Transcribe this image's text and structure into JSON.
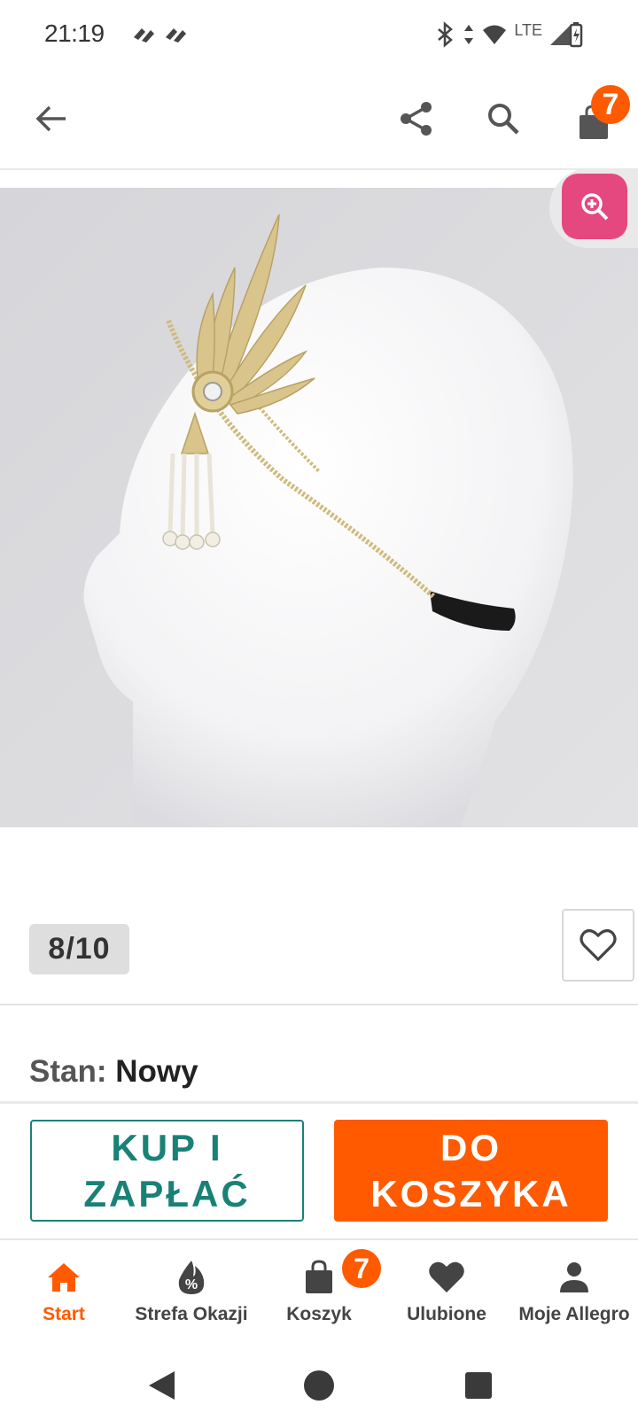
{
  "status_bar": {
    "time": "21:19",
    "network": "LTE"
  },
  "header": {
    "cart_count": "7",
    "icons": [
      "back-arrow-icon",
      "share-icon",
      "search-icon",
      "shopping-bag-icon"
    ]
  },
  "gallery": {
    "counter": "8/10",
    "zoom_icon": "zoom-in-icon"
  },
  "product": {
    "condition_label": "Stan:",
    "condition_value": "Nowy"
  },
  "actions": {
    "buy_now_line1": "KUP I",
    "buy_now_line2": "ZAPŁAĆ",
    "add_to_cart_line1": "DO",
    "add_to_cart_line2": "KOSZYKA"
  },
  "bottom_nav": {
    "items": [
      {
        "label": "Start",
        "icon": "home-icon",
        "active": true
      },
      {
        "label": "Strefa Okazji",
        "icon": "deals-icon",
        "active": false
      },
      {
        "label": "Koszyk",
        "icon": "shopping-bag-icon",
        "active": false,
        "badge": "7"
      },
      {
        "label": "Ulubione",
        "icon": "heart-icon",
        "active": false
      },
      {
        "label": "Moje Allegro",
        "icon": "person-icon",
        "active": false
      }
    ]
  },
  "colors": {
    "brand_orange": "#ff5a00",
    "teal": "#1a8176",
    "zoom_pink": "#e5487f"
  }
}
